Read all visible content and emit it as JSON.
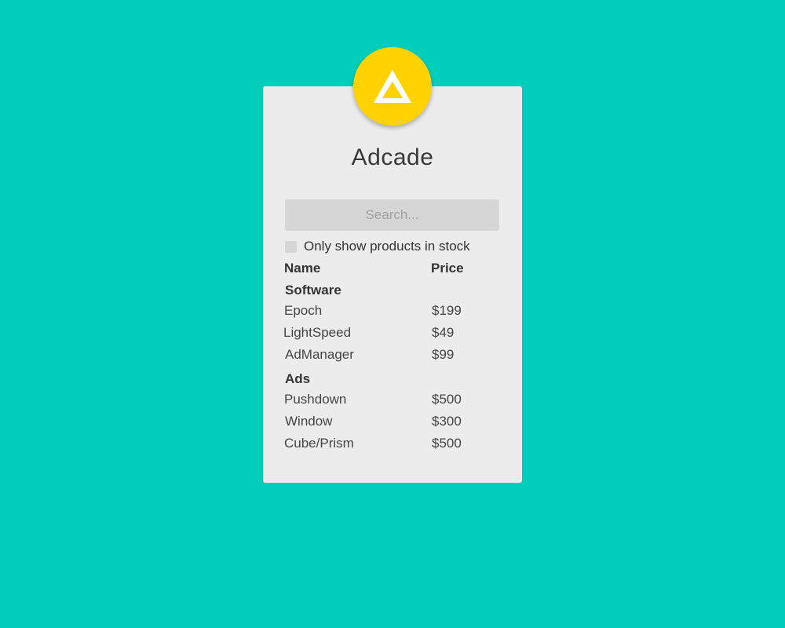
{
  "app": {
    "title": "Adcade",
    "logo_icon": "triangle-logo-icon",
    "colors": {
      "background": "#00cebb",
      "logo": "#ffd200",
      "card": "#ececec"
    }
  },
  "search": {
    "placeholder": "Search...",
    "value": ""
  },
  "stock_filter": {
    "label": "Only show products in stock",
    "checked": false
  },
  "table": {
    "headers": {
      "name": "Name",
      "price": "Price"
    },
    "categories": [
      {
        "name": "Software",
        "products": [
          {
            "name": "Epoch",
            "price": "$199"
          },
          {
            "name": "LightSpeed",
            "price": "$49"
          },
          {
            "name": "AdManager",
            "price": "$99"
          }
        ]
      },
      {
        "name": "Ads",
        "products": [
          {
            "name": "Pushdown",
            "price": "$500"
          },
          {
            "name": "Window",
            "price": "$300"
          },
          {
            "name": "Cube/Prism",
            "price": "$500"
          }
        ]
      }
    ]
  }
}
